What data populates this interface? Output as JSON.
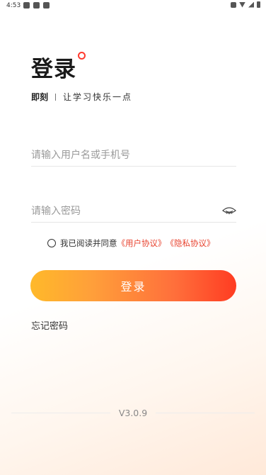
{
  "status_bar": {
    "time": "4:53"
  },
  "header": {
    "title": "登录",
    "brand": "即刻",
    "slogan": "让学习快乐一点",
    "accent_color": "#ff3b2f"
  },
  "form": {
    "username_placeholder": "请输入用户名或手机号",
    "password_placeholder": "请输入密码",
    "password_toggle_icon": "eye-closed-icon"
  },
  "agreement": {
    "checked": false,
    "text": "我已阅读并同意",
    "user_agreement": "《用户协议》",
    "privacy_policy": "《隐私协议》",
    "link_color": "#e8432f"
  },
  "actions": {
    "login_label": "登录",
    "forgot_password": "忘记密码"
  },
  "footer": {
    "version": "V3.0.9"
  }
}
